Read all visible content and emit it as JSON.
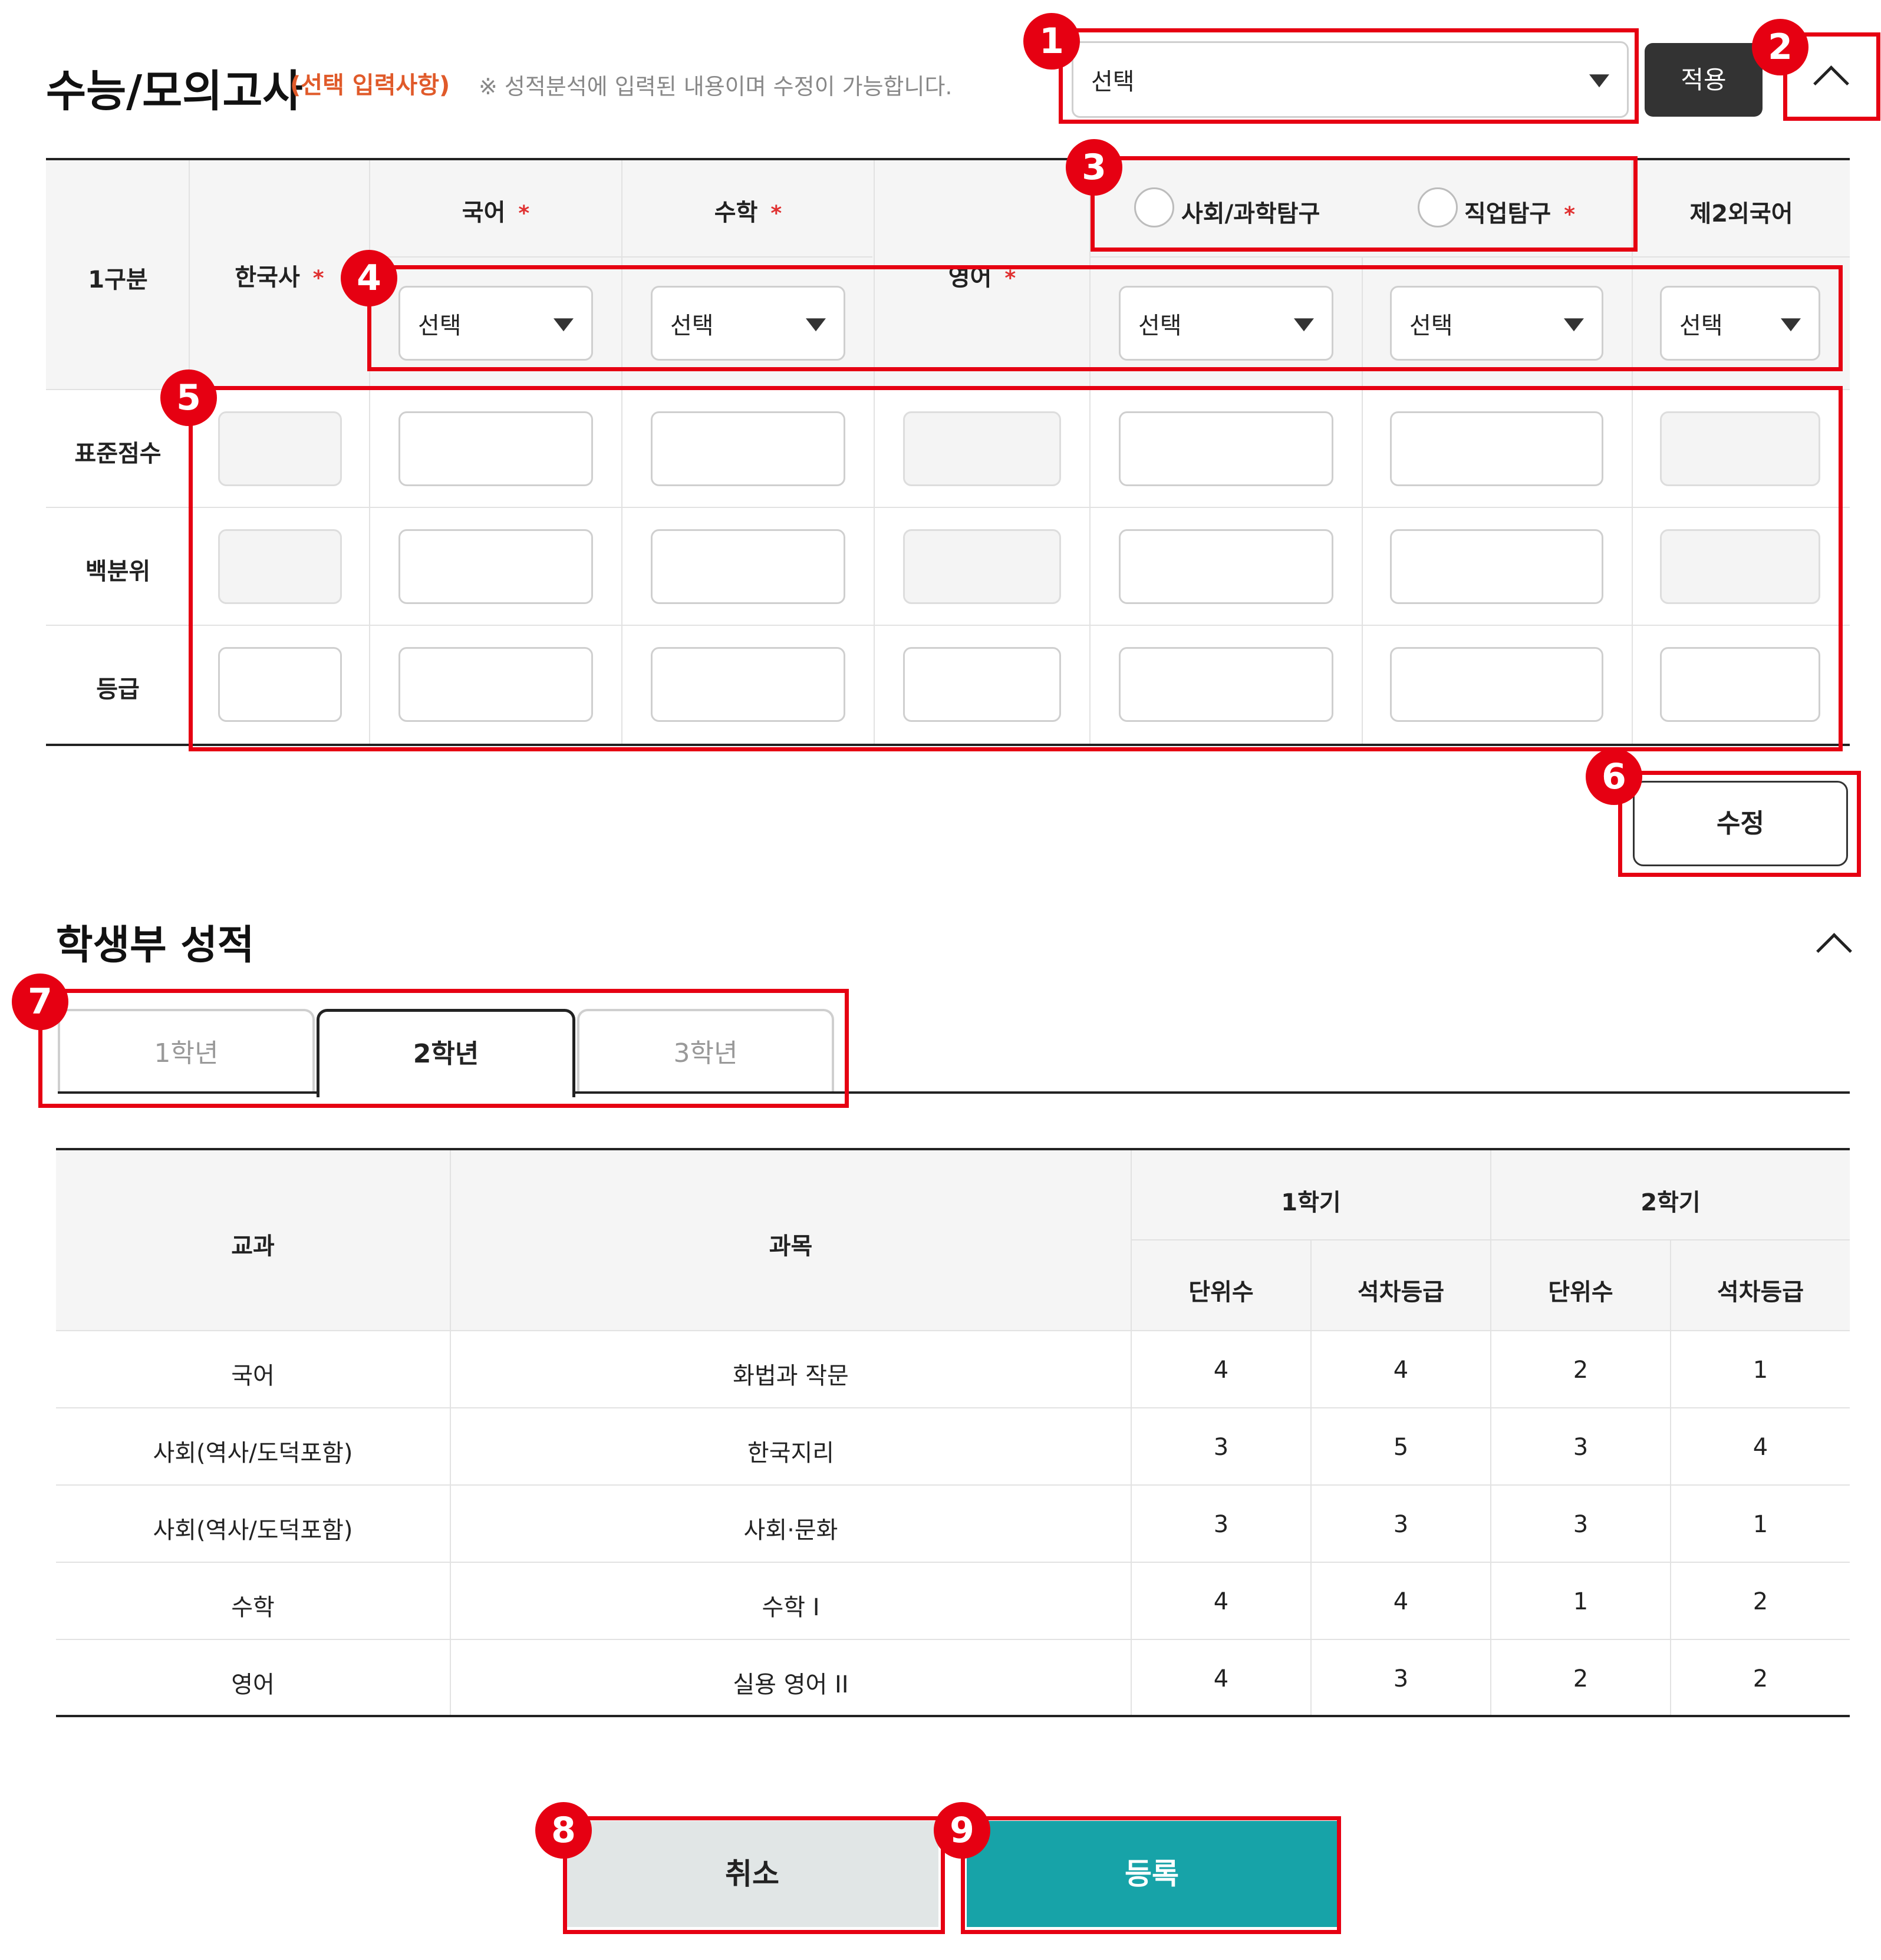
{
  "suneung": {
    "title": "수능/모의고사",
    "subtitle": "(선택 입력사항)",
    "note": "※ 성적분석에 입력된 내용이며 수정이 가능합니다.",
    "exam_select": "선택",
    "apply_button": "적용",
    "columns": {
      "category": "1구분",
      "korean_history": "한국사",
      "korean": "국어",
      "math": "수학",
      "english": "영어",
      "social_science": "사회/과학탐구",
      "vocational": "직업탐구",
      "second_foreign": "제2외국어",
      "required_mark": "*"
    },
    "subject_select": "선택",
    "rows": [
      "표준점수",
      "백분위",
      "등급"
    ],
    "edit_button": "수정"
  },
  "record": {
    "title": "학생부 성적",
    "tabs": [
      "1학년",
      "2학년",
      "3학년"
    ],
    "active_tab": "2학년",
    "headers": {
      "subject_group": "교과",
      "subject": "과목",
      "semester1": "1학기",
      "semester2": "2학기",
      "units": "단위수",
      "rank": "석차등급"
    },
    "rows": [
      {
        "group": "국어",
        "subject": "화법과 작문",
        "s1_units": "4",
        "s1_rank": "4",
        "s2_units": "2",
        "s2_rank": "1"
      },
      {
        "group": "사회(역사/도덕포함)",
        "subject": "한국지리",
        "s1_units": "3",
        "s1_rank": "5",
        "s2_units": "3",
        "s2_rank": "4"
      },
      {
        "group": "사회(역사/도덕포함)",
        "subject": "사회·문화",
        "s1_units": "3",
        "s1_rank": "3",
        "s2_units": "3",
        "s2_rank": "1"
      },
      {
        "group": "수학",
        "subject": "수학 I",
        "s1_units": "4",
        "s1_rank": "4",
        "s2_units": "1",
        "s2_rank": "2"
      },
      {
        "group": "영어",
        "subject": "실용 영어 II",
        "s1_units": "4",
        "s1_rank": "3",
        "s2_units": "2",
        "s2_rank": "2"
      }
    ]
  },
  "actions": {
    "cancel": "취소",
    "submit": "등록"
  },
  "badges": [
    "1",
    "2",
    "3",
    "4",
    "5",
    "6",
    "7",
    "8",
    "9"
  ],
  "colors": {
    "accent_red": "#e60012",
    "submit_teal": "#17a3a8",
    "cancel_gray": "#e1e6e6",
    "apply_dark": "#333333",
    "required_red": "#e03030"
  }
}
